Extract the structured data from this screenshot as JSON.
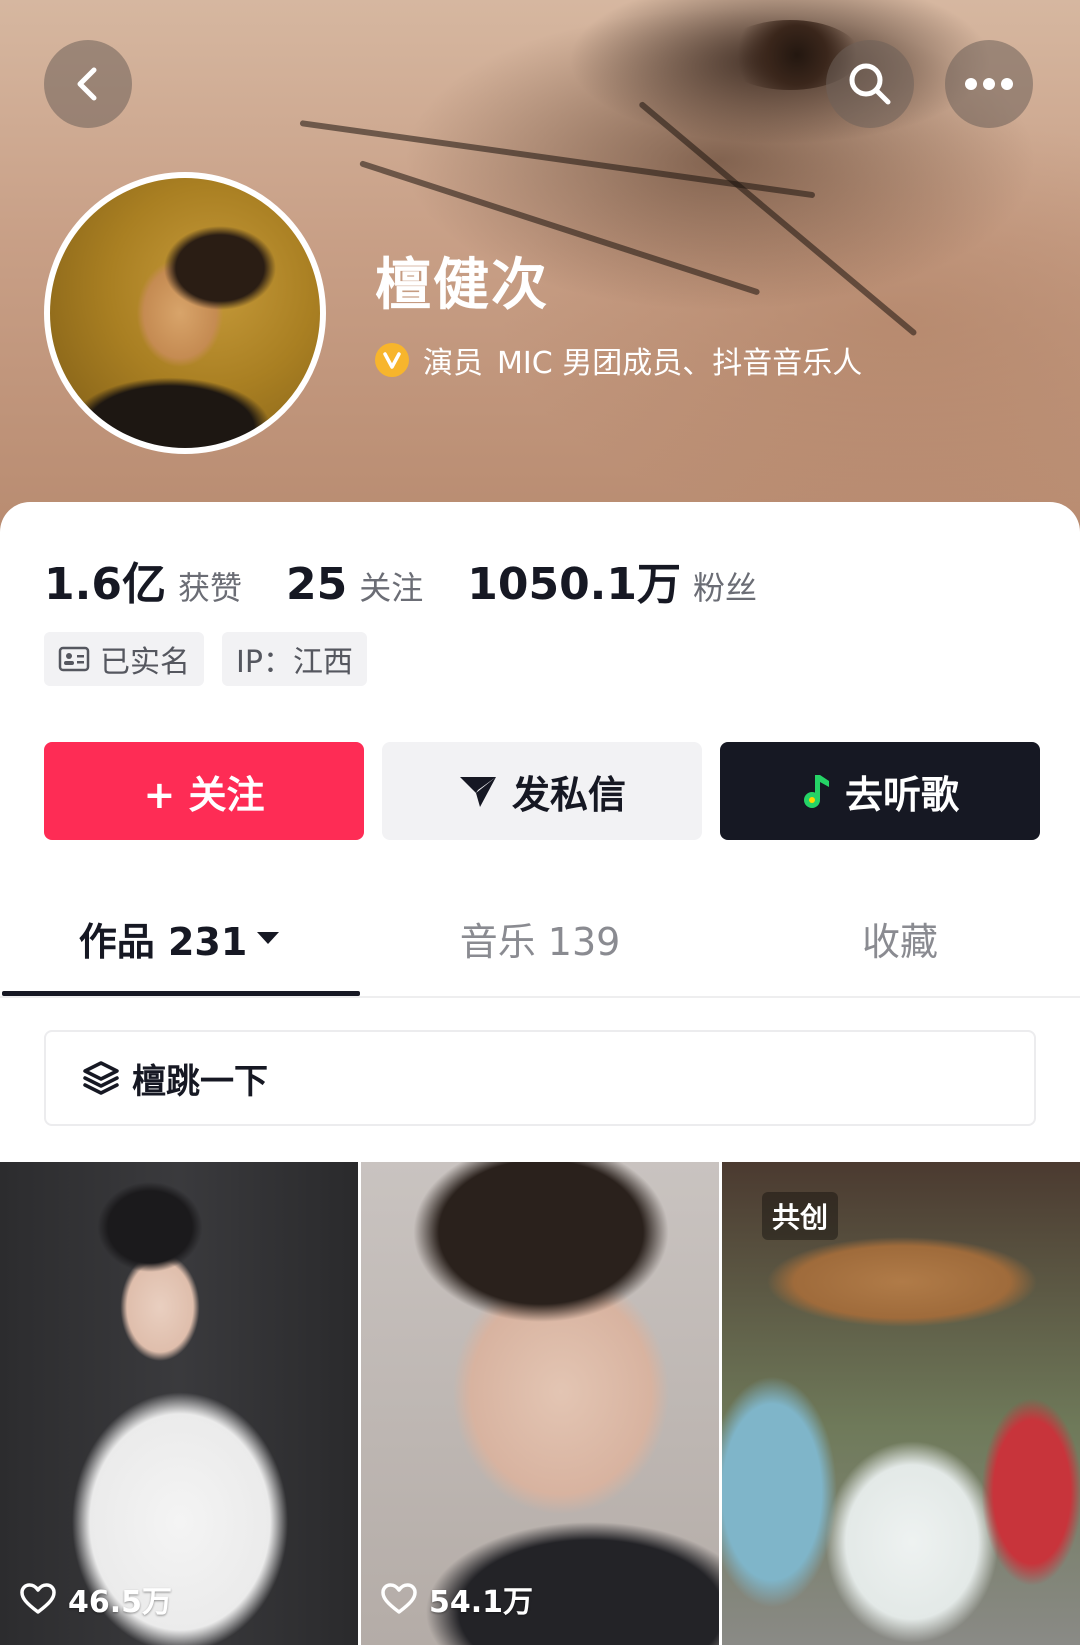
{
  "header": {
    "back_icon": "chevron-left-icon",
    "search_icon": "search-icon",
    "more_icon": "more-dots-icon"
  },
  "profile": {
    "name": "檀健次",
    "verified_icon": "verified-v-icon",
    "verified_color": "#f7b52c",
    "bio_role": "演员",
    "bio_groups": "MIC 男团成员、抖音音乐人"
  },
  "stats": [
    {
      "value": "1.6亿",
      "label": "获赞"
    },
    {
      "value": "25",
      "label": "关注"
    },
    {
      "value": "1050.1万",
      "label": "粉丝"
    }
  ],
  "tags": {
    "verified_name": "已实名",
    "ip": "IP：江西"
  },
  "actions": {
    "follow": "+ 关注",
    "message": "发私信",
    "music": "去听歌",
    "follow_color": "#fe2c55",
    "music_color": "#161823"
  },
  "tabs": [
    {
      "label": "作品 231",
      "active": true
    },
    {
      "label": "音乐 139",
      "active": false
    },
    {
      "label": "收藏",
      "active": false
    }
  ],
  "collection": {
    "label": "檀跳一下",
    "icon": "layers-icon"
  },
  "videos": [
    {
      "likes": "46.5万"
    },
    {
      "likes": "54.1万"
    },
    {
      "badge": "共创"
    }
  ]
}
